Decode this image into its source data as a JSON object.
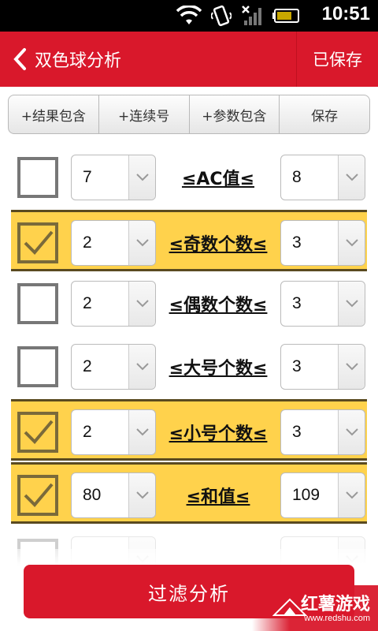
{
  "status_bar": {
    "time": "10:51"
  },
  "header": {
    "title": "双色球分析",
    "saved_label": "已保存"
  },
  "toolbar": {
    "buttons": [
      "+结果包含",
      "+连续号",
      "+参数包含",
      "保存"
    ]
  },
  "rows": [
    {
      "label": "≤AC值≤",
      "min": "7",
      "max": "8",
      "checked": false
    },
    {
      "label": "≤奇数个数≤",
      "min": "2",
      "max": "3",
      "checked": true
    },
    {
      "label": "≤偶数个数≤",
      "min": "2",
      "max": "3",
      "checked": false
    },
    {
      "label": "≤大号个数≤",
      "min": "2",
      "max": "3",
      "checked": false
    },
    {
      "label": "≤小号个数≤",
      "min": "2",
      "max": "3",
      "checked": true
    },
    {
      "label": "≤和值≤",
      "min": "80",
      "max": "109",
      "checked": true
    }
  ],
  "filter_button": {
    "label": "过滤分析"
  },
  "watermark": {
    "brand": "红薯游戏",
    "url": "www.redshu.com"
  },
  "colors": {
    "accent": "#d9182b",
    "highlight": "#ffd24c"
  }
}
